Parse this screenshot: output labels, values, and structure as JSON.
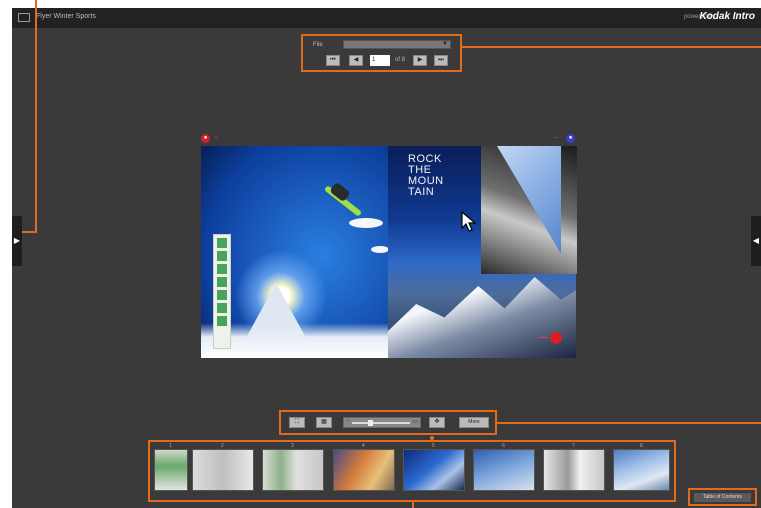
{
  "topbar": {
    "title": "Flyer Winter Sports",
    "powered_by": "powered by",
    "brand": "Kodak Intro"
  },
  "navigator": {
    "file_label": "File",
    "page_value": "1",
    "page_total": "of 8"
  },
  "book": {
    "headline": [
      "ROCK",
      "THE",
      "MOUN",
      "TAIN"
    ]
  },
  "view_toolbar": {
    "label_button": "More"
  },
  "thumbnails": {
    "numbers": [
      "1",
      "2",
      "3",
      "4",
      "5",
      "6",
      "7",
      "8"
    ]
  },
  "contents_button": "Table of Contents",
  "colors": {
    "callout": "#e06a1f",
    "app_bg": "#3a3a3a"
  }
}
